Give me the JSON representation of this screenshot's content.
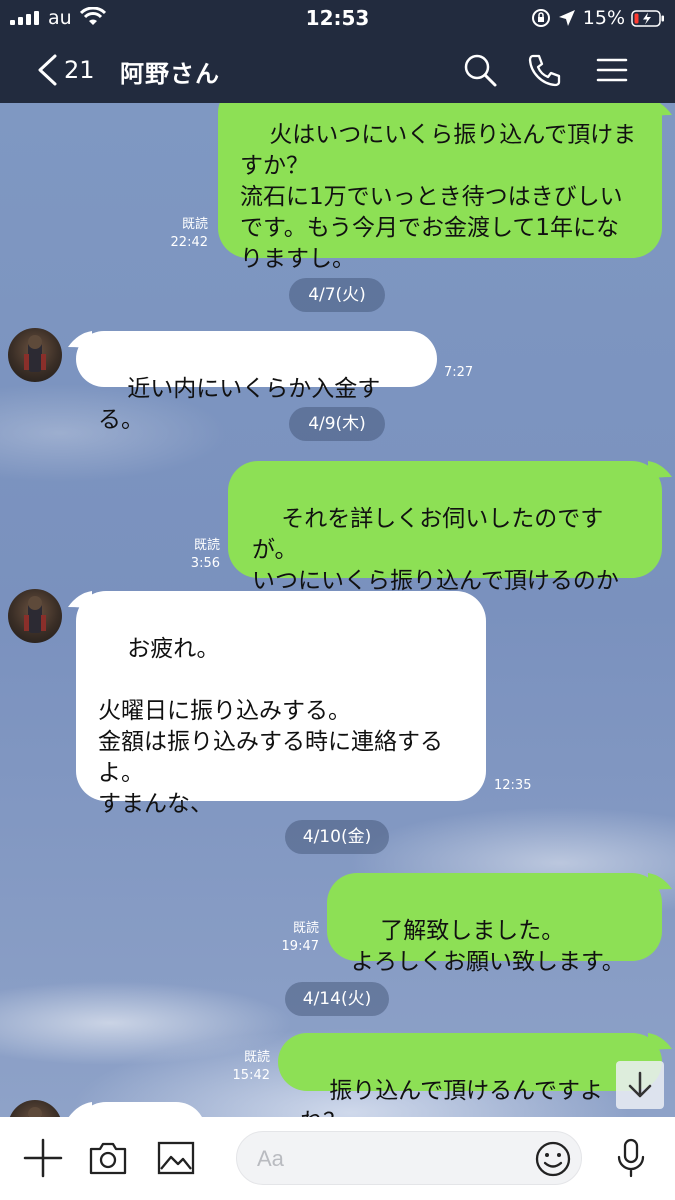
{
  "status_bar": {
    "carrier": "au",
    "time": "12:53",
    "battery": "15%"
  },
  "header": {
    "back_count": "21",
    "title": "阿野さん",
    "icons": [
      "search-icon",
      "phone-icon",
      "menu-icon"
    ]
  },
  "colors": {
    "header_bg": "#222b3e",
    "my_bubble": "#8de055",
    "their_bubble": "#ffffff",
    "chat_bg": "#7b93bd"
  },
  "messages": [
    {
      "side": "me",
      "text": "火はいつにいくら振り込んで頂けま\nすか？\n流石に1万でいっとき待つはきびしい\nです。もう今月でお金渡して1年にな\nりますし。",
      "read": "既読",
      "time": "22:42"
    },
    {
      "type": "date",
      "text": "4/7(火)"
    },
    {
      "side": "them",
      "text": "近い内にいくらか入金する。",
      "time": "7:27"
    },
    {
      "type": "date",
      "text": "4/9(木)"
    },
    {
      "side": "me",
      "text": "それを詳しくお伺いしたのですが。\nいつにいくら振り込んで頂けるのか\nを。",
      "read": "既読",
      "time": "3:56"
    },
    {
      "side": "them",
      "text": "お疲れ。\n\n火曜日に振り込みする。\n金額は振り込みする時に連絡する\nよ。\nすまんな、",
      "time": "12:35"
    },
    {
      "type": "date",
      "text": "4/10(金)"
    },
    {
      "side": "me",
      "text": "了解致しました。\nよろしくお願い致します。",
      "read": "既読",
      "time": "19:47"
    },
    {
      "type": "date",
      "text": "4/14(火)"
    },
    {
      "side": "me",
      "text": "振り込んで頂けるんですよね？",
      "read": "既読",
      "time": "15:42"
    }
  ],
  "input": {
    "placeholder": "Aa"
  }
}
